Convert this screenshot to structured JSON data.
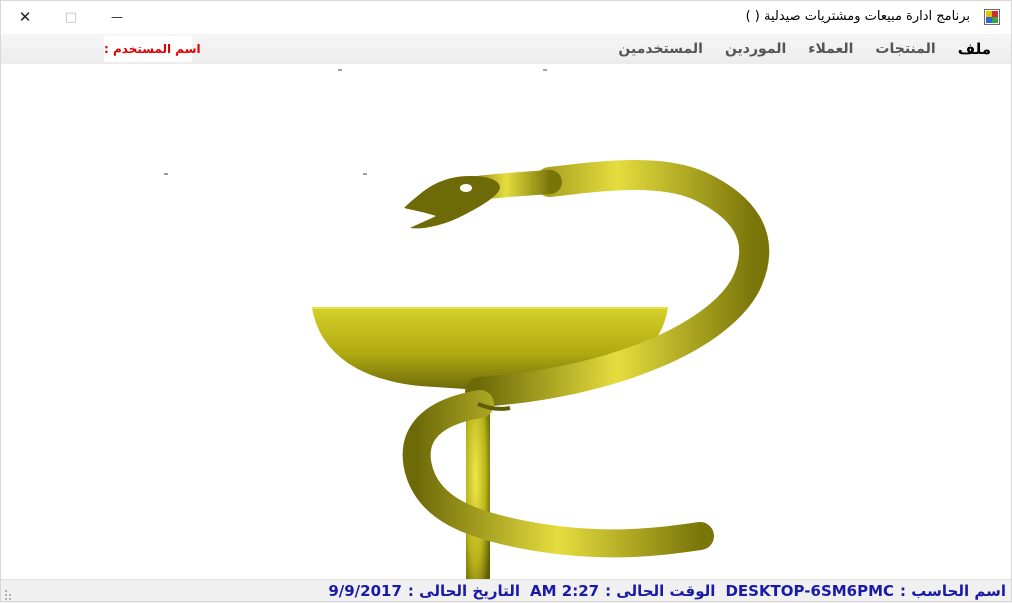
{
  "window": {
    "title": "برنامج ادارة مبيعات ومشتريات صيدلية ( )",
    "controls": {
      "close": "✕",
      "maximize": "□",
      "minimize": "—"
    }
  },
  "menu": {
    "items": [
      {
        "label": "ملف"
      },
      {
        "label": "المنتجات"
      },
      {
        "label": "العملاء"
      },
      {
        "label": "الموردين"
      },
      {
        "label": "المستخدمين"
      }
    ],
    "user_label": "اسم المستخدم :"
  },
  "status": {
    "computer_label": "اسم الحاسب :",
    "computer_value": "DESKTOP-6SM6PMC",
    "time_label": "الوقت الحالى :",
    "time_value": "AM 2:27",
    "date_label": "التاريخ الحالى :",
    "date_value": "9/9/2017"
  },
  "colors": {
    "logo_gold": "#c8c21a",
    "logo_dark": "#5d5a08",
    "user_label": "#e00000",
    "status_text": "#1a1aa8"
  },
  "icons": {
    "app": "pharmacy-app-icon",
    "logo": "bowl-of-hygieia-icon"
  }
}
